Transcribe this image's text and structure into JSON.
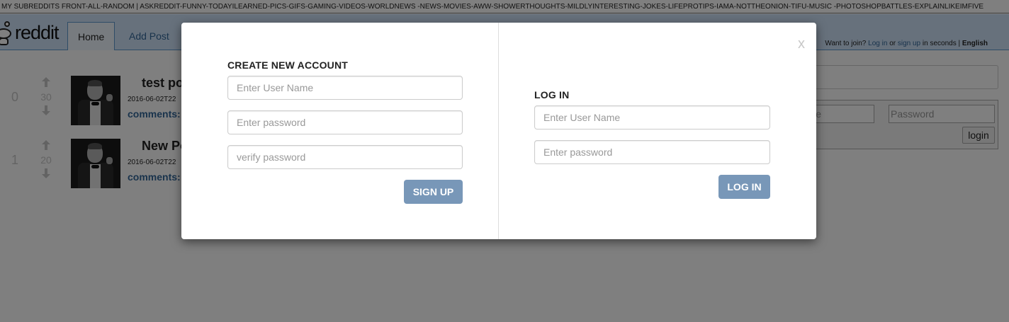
{
  "subreddit_bar": {
    "text": "MY SUBREDDITS FRONT-ALL-RANDOM | ASKREDDIT-FUNNY-TODAYILEARNED-PICS-GIFS-GAMING-VIDEOS-WORLDNEWS -NEWS-MOVIES-AWW-SHOWERTHOUGHTS-MILDLYINTERESTING-JOKES-LIFEPROTIPS-IAMA-NOTTHEONION-TIFU-MUSIC -PHOTOSHOPBATTLES-EXPLAINLIKEIMFIVE"
  },
  "header": {
    "logo_text": "reddit",
    "tabs": [
      {
        "label": "Home"
      },
      {
        "label": "Add Post"
      }
    ]
  },
  "userbar": {
    "prefix": "Want to join?",
    "login_link": "Log in",
    "or": "or",
    "signup_link": "sign up",
    "suffix": "in seconds |",
    "language": "English"
  },
  "sidebar": {
    "username_placeholder": "e",
    "password_placeholder": "Password",
    "login_button": "login"
  },
  "posts": [
    {
      "rank": "0",
      "score": "30",
      "title": "test po",
      "date": "2016-06-02T22",
      "comments": "comments:"
    },
    {
      "rank": "1",
      "score": "20",
      "title": "New Po",
      "date": "2016-06-02T22",
      "comments": "comments:"
    }
  ],
  "modal": {
    "close_label": "x",
    "signup": {
      "heading": "CREATE NEW ACCOUNT",
      "username_placeholder": "Enter User Name",
      "password_placeholder": "Enter password",
      "verify_placeholder": "verify password",
      "button": "SIGN UP"
    },
    "login": {
      "heading": "LOG IN",
      "username_placeholder": "Enter User Name",
      "password_placeholder": "Enter password",
      "button": "LOG IN"
    }
  },
  "colors": {
    "header_bg": "#cee3f8",
    "link": "#336699",
    "button": "#7897b8"
  }
}
